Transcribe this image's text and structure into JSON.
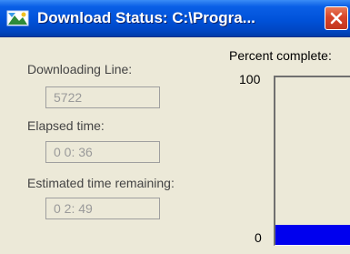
{
  "window": {
    "title": "Download Status:  C:\\Progra...",
    "icon": "download-app-icon",
    "close_icon": "close-icon"
  },
  "downloading_line": {
    "label": "Downloading Line:",
    "value": "5722"
  },
  "elapsed_time": {
    "label": "Elapsed time:",
    "value": "0 0: 36"
  },
  "estimated_remaining": {
    "label": "Estimated time remaining:",
    "value": "0 2: 49"
  },
  "progress": {
    "label": "Percent complete:",
    "max_label": "100",
    "min_label": "0",
    "percent": 12,
    "fill_color": "#0000ee"
  }
}
